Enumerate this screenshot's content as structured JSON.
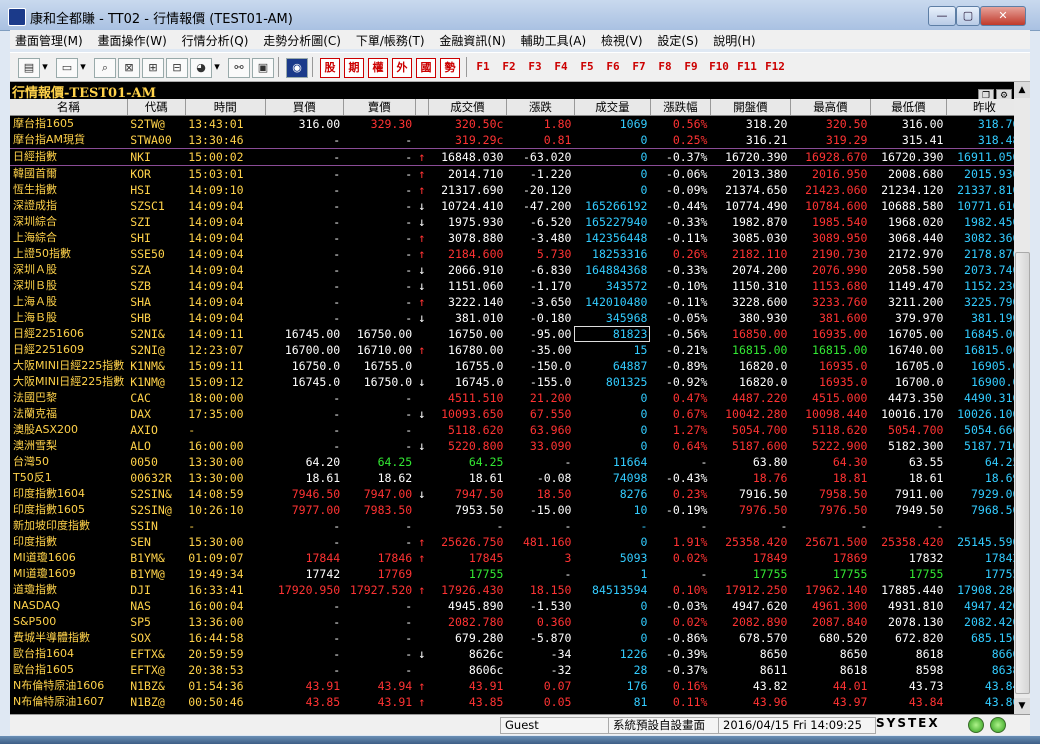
{
  "window": {
    "title": "康和全都賺 - TT02 - 行情報價 (TEST01-AM)",
    "minimize": "—",
    "maximize": "▢",
    "close": "✕"
  },
  "menu": [
    "畫面管理(M)",
    "畫面操作(W)",
    "行情分析(Q)",
    "走勢分析圖(C)",
    "下單/帳務(T)",
    "金融資訊(N)",
    "輔助工具(A)",
    "檢視(V)",
    "設定(S)",
    "說明(H)"
  ],
  "toolbar": {
    "red_buttons": [
      "股",
      "期",
      "權",
      "外",
      "國",
      "勢"
    ],
    "fkeys": [
      "F1",
      "F2",
      "F3",
      "F4",
      "F5",
      "F6",
      "F7",
      "F8",
      "F9",
      "F10",
      "F11",
      "F12"
    ]
  },
  "panel": {
    "title": "行情報價-TEST01-AM"
  },
  "columns": [
    "名稱",
    "代碼",
    "時間",
    "買價",
    "賣價",
    "成交價",
    "漲跌",
    "成交量",
    "漲跌幅",
    "開盤價",
    "最高價",
    "最低價",
    "昨收"
  ],
  "rows": [
    {
      "name": "摩台指1605",
      "code": "S2TW@",
      "time": "13:43:01",
      "bid": "316.00",
      "bidc": "w",
      "ask": "329.30",
      "askc": "r",
      "arrow": "",
      "last": "320.50c",
      "lastc": "r",
      "chg": "1.80",
      "chgc": "r",
      "vol": "1069",
      "pct": "0.56%",
      "pctc": "r",
      "open": "318.20",
      "openc": "w",
      "high": "320.50",
      "highc": "r",
      "low": "316.00",
      "lowc": "w",
      "prev": "318.70"
    },
    {
      "name": "摩台指AM現貨",
      "code": "STWA00",
      "time": "13:30:46",
      "bid": "-",
      "bidc": "w",
      "ask": "-",
      "askc": "w",
      "arrow": "",
      "last": "319.29c",
      "lastc": "r",
      "chg": "0.81",
      "chgc": "r",
      "vol": "0",
      "pct": "0.25%",
      "pctc": "r",
      "open": "316.21",
      "openc": "w",
      "high": "319.29",
      "highc": "r",
      "low": "315.41",
      "lowc": "w",
      "prev": "318.48"
    },
    {
      "name": "日經指數",
      "code": "NKI",
      "time": "15:00:02",
      "bid": "-",
      "bidc": "w",
      "ask": "-",
      "askc": "w",
      "arrow": "↑",
      "last": "16848.030",
      "lastc": "w",
      "chg": "-63.020",
      "chgc": "w",
      "vol": "0",
      "pct": "-0.37%",
      "pctc": "w",
      "open": "16720.390",
      "openc": "w",
      "high": "16928.670",
      "highc": "r",
      "low": "16720.390",
      "lowc": "w",
      "prev": "16911.050",
      "sel": true
    },
    {
      "name": "韓國首爾",
      "code": "KOR",
      "time": "15:03:01",
      "bid": "-",
      "bidc": "w",
      "ask": "-",
      "askc": "w",
      "arrow": "↑",
      "last": "2014.710",
      "lastc": "w",
      "chg": "-1.220",
      "chgc": "w",
      "vol": "0",
      "pct": "-0.06%",
      "pctc": "w",
      "open": "2013.380",
      "openc": "w",
      "high": "2016.950",
      "highc": "r",
      "low": "2008.680",
      "lowc": "w",
      "prev": "2015.930"
    },
    {
      "name": "恆生指數",
      "code": "HSI",
      "time": "14:09:10",
      "bid": "-",
      "bidc": "w",
      "ask": "-",
      "askc": "w",
      "arrow": "↑",
      "last": "21317.690",
      "lastc": "w",
      "chg": "-20.120",
      "chgc": "w",
      "vol": "0",
      "pct": "-0.09%",
      "pctc": "w",
      "open": "21374.650",
      "openc": "w",
      "high": "21423.060",
      "highc": "r",
      "low": "21234.120",
      "lowc": "w",
      "prev": "21337.810"
    },
    {
      "name": "深證成指",
      "code": "SZSC1",
      "time": "14:09:04",
      "bid": "-",
      "bidc": "w",
      "ask": "-",
      "askc": "w",
      "arrow": "↓",
      "last": "10724.410",
      "lastc": "w",
      "chg": "-47.200",
      "chgc": "w",
      "vol": "165266192",
      "pct": "-0.44%",
      "pctc": "w",
      "open": "10774.490",
      "openc": "w",
      "high": "10784.600",
      "highc": "r",
      "low": "10688.580",
      "lowc": "w",
      "prev": "10771.610"
    },
    {
      "name": "深圳綜合",
      "code": "SZI",
      "time": "14:09:04",
      "bid": "-",
      "bidc": "w",
      "ask": "-",
      "askc": "w",
      "arrow": "↓",
      "last": "1975.930",
      "lastc": "w",
      "chg": "-6.520",
      "chgc": "w",
      "vol": "165227940",
      "pct": "-0.33%",
      "pctc": "w",
      "open": "1982.870",
      "openc": "w",
      "high": "1985.540",
      "highc": "r",
      "low": "1968.020",
      "lowc": "w",
      "prev": "1982.450"
    },
    {
      "name": "上海綜合",
      "code": "SHI",
      "time": "14:09:04",
      "bid": "-",
      "bidc": "w",
      "ask": "-",
      "askc": "w",
      "arrow": "↑",
      "last": "3078.880",
      "lastc": "w",
      "chg": "-3.480",
      "chgc": "w",
      "vol": "142356448",
      "pct": "-0.11%",
      "pctc": "w",
      "open": "3085.030",
      "openc": "w",
      "high": "3089.950",
      "highc": "r",
      "low": "3068.440",
      "lowc": "w",
      "prev": "3082.360"
    },
    {
      "name": "上證50指數",
      "code": "SSE50",
      "time": "14:09:04",
      "bid": "-",
      "bidc": "w",
      "ask": "-",
      "askc": "w",
      "arrow": "↑",
      "last": "2184.600",
      "lastc": "r",
      "chg": "5.730",
      "chgc": "r",
      "vol": "18253316",
      "pct": "0.26%",
      "pctc": "r",
      "open": "2182.110",
      "openc": "r",
      "high": "2190.730",
      "highc": "r",
      "low": "2172.970",
      "lowc": "w",
      "prev": "2178.870"
    },
    {
      "name": "深圳Ａ股",
      "code": "SZA",
      "time": "14:09:04",
      "bid": "-",
      "bidc": "w",
      "ask": "-",
      "askc": "w",
      "arrow": "↓",
      "last": "2066.910",
      "lastc": "w",
      "chg": "-6.830",
      "chgc": "w",
      "vol": "164884368",
      "pct": "-0.33%",
      "pctc": "w",
      "open": "2074.200",
      "openc": "w",
      "high": "2076.990",
      "highc": "r",
      "low": "2058.590",
      "lowc": "w",
      "prev": "2073.740"
    },
    {
      "name": "深圳Ｂ股",
      "code": "SZB",
      "time": "14:09:04",
      "bid": "-",
      "bidc": "w",
      "ask": "-",
      "askc": "w",
      "arrow": "↓",
      "last": "1151.060",
      "lastc": "w",
      "chg": "-1.170",
      "chgc": "w",
      "vol": "343572",
      "pct": "-0.10%",
      "pctc": "w",
      "open": "1150.310",
      "openc": "w",
      "high": "1153.680",
      "highc": "r",
      "low": "1149.470",
      "lowc": "w",
      "prev": "1152.230"
    },
    {
      "name": "上海Ａ股",
      "code": "SHA",
      "time": "14:09:04",
      "bid": "-",
      "bidc": "w",
      "ask": "-",
      "askc": "w",
      "arrow": "↑",
      "last": "3222.140",
      "lastc": "w",
      "chg": "-3.650",
      "chgc": "w",
      "vol": "142010480",
      "pct": "-0.11%",
      "pctc": "w",
      "open": "3228.600",
      "openc": "w",
      "high": "3233.760",
      "highc": "r",
      "low": "3211.200",
      "lowc": "w",
      "prev": "3225.790"
    },
    {
      "name": "上海Ｂ股",
      "code": "SHB",
      "time": "14:09:04",
      "bid": "-",
      "bidc": "w",
      "ask": "-",
      "askc": "w",
      "arrow": "↓",
      "last": "381.010",
      "lastc": "w",
      "chg": "-0.180",
      "chgc": "w",
      "vol": "345968",
      "pct": "-0.05%",
      "pctc": "w",
      "open": "380.930",
      "openc": "w",
      "high": "381.600",
      "highc": "r",
      "low": "379.970",
      "lowc": "w",
      "prev": "381.190"
    },
    {
      "name": "日經2251606",
      "code": "S2NI&",
      "time": "14:09:11",
      "bid": "16745.00",
      "bidc": "w",
      "ask": "16750.00",
      "askc": "w",
      "arrow": "",
      "last": "16750.00",
      "lastc": "w",
      "chg": "-95.00",
      "chgc": "w",
      "vol": "81823",
      "volbox": true,
      "pct": "-0.56%",
      "pctc": "w",
      "open": "16850.00",
      "openc": "r",
      "high": "16935.00",
      "highc": "r",
      "low": "16705.00",
      "lowc": "w",
      "prev": "16845.00"
    },
    {
      "name": "日經2251609",
      "code": "S2NI@",
      "time": "12:23:07",
      "bid": "16700.00",
      "bidc": "w",
      "ask": "16710.00",
      "askc": "w",
      "arrow": "↑",
      "last": "16780.00",
      "lastc": "w",
      "chg": "-35.00",
      "chgc": "w",
      "vol": "15",
      "pct": "-0.21%",
      "pctc": "w",
      "open": "16815.00",
      "openc": "g",
      "high": "16815.00",
      "highc": "g",
      "low": "16740.00",
      "lowc": "w",
      "prev": "16815.00"
    },
    {
      "name": "大阪MINI日經225指數",
      "code": "K1NM&",
      "time": "15:09:11",
      "bid": "16750.0",
      "bidc": "w",
      "ask": "16755.0",
      "askc": "w",
      "arrow": "",
      "last": "16755.0",
      "lastc": "w",
      "chg": "-150.0",
      "chgc": "w",
      "vol": "64887",
      "pct": "-0.89%",
      "pctc": "w",
      "open": "16820.0",
      "openc": "w",
      "high": "16935.0",
      "highc": "r",
      "low": "16705.0",
      "lowc": "w",
      "prev": "16905.0"
    },
    {
      "name": "大阪MINI日經225指數",
      "code": "K1NM@",
      "time": "15:09:12",
      "bid": "16745.0",
      "bidc": "w",
      "ask": "16750.0",
      "askc": "w",
      "arrow": "↓",
      "last": "16745.0",
      "lastc": "w",
      "chg": "-155.0",
      "chgc": "w",
      "vol": "801325",
      "pct": "-0.92%",
      "pctc": "w",
      "open": "16820.0",
      "openc": "w",
      "high": "16935.0",
      "highc": "r",
      "low": "16700.0",
      "lowc": "w",
      "prev": "16900.0"
    },
    {
      "name": "法國巴黎",
      "code": "CAC",
      "time": "18:00:00",
      "bid": "-",
      "bidc": "w",
      "ask": "-",
      "askc": "w",
      "arrow": "",
      "last": "4511.510",
      "lastc": "r",
      "chg": "21.200",
      "chgc": "r",
      "vol": "0",
      "pct": "0.47%",
      "pctc": "r",
      "open": "4487.220",
      "openc": "r",
      "high": "4515.000",
      "highc": "r",
      "low": "4473.350",
      "lowc": "w",
      "prev": "4490.310"
    },
    {
      "name": "法蘭克福",
      "code": "DAX",
      "time": "17:35:00",
      "bid": "-",
      "bidc": "w",
      "ask": "-",
      "askc": "w",
      "arrow": "↓",
      "last": "10093.650",
      "lastc": "r",
      "chg": "67.550",
      "chgc": "r",
      "vol": "0",
      "pct": "0.67%",
      "pctc": "r",
      "open": "10042.280",
      "openc": "r",
      "high": "10098.440",
      "highc": "r",
      "low": "10016.170",
      "lowc": "w",
      "prev": "10026.100"
    },
    {
      "name": "澳股ASX200",
      "code": "AXIO",
      "time": "-",
      "bid": "-",
      "bidc": "w",
      "ask": "-",
      "askc": "w",
      "arrow": "",
      "last": "5118.620",
      "lastc": "r",
      "chg": "63.960",
      "chgc": "r",
      "vol": "0",
      "pct": "1.27%",
      "pctc": "r",
      "open": "5054.700",
      "openc": "r",
      "high": "5118.620",
      "highc": "r",
      "low": "5054.700",
      "lowc": "r",
      "prev": "5054.660"
    },
    {
      "name": "澳洲雪梨",
      "code": "ALO",
      "time": "16:00:00",
      "bid": "-",
      "bidc": "w",
      "ask": "-",
      "askc": "w",
      "arrow": "↓",
      "last": "5220.800",
      "lastc": "r",
      "chg": "33.090",
      "chgc": "r",
      "vol": "0",
      "pct": "0.64%",
      "pctc": "r",
      "open": "5187.600",
      "openc": "r",
      "high": "5222.900",
      "highc": "r",
      "low": "5182.300",
      "lowc": "w",
      "prev": "5187.710"
    },
    {
      "name": "台灣50",
      "code": "0050",
      "time": "13:30:00",
      "bid": "64.20",
      "bidc": "w",
      "ask": "64.25",
      "askc": "g",
      "arrow": "",
      "last": "64.25",
      "lastc": "g",
      "chg": "-",
      "chgc": "w",
      "vol": "11664",
      "pct": "-",
      "pctc": "w",
      "open": "63.80",
      "openc": "w",
      "high": "64.30",
      "highc": "r",
      "low": "63.55",
      "lowc": "w",
      "prev": "64.25"
    },
    {
      "name": "T50反1",
      "code": "00632R",
      "time": "13:30:00",
      "bid": "18.61",
      "bidc": "w",
      "ask": "18.62",
      "askc": "w",
      "arrow": "",
      "last": "18.61",
      "lastc": "w",
      "chg": "-0.08",
      "chgc": "w",
      "vol": "74098",
      "pct": "-0.43%",
      "pctc": "w",
      "open": "18.76",
      "openc": "r",
      "high": "18.81",
      "highc": "r",
      "low": "18.61",
      "lowc": "w",
      "prev": "18.69"
    },
    {
      "name": "印度指數1604",
      "code": "S2SIN&",
      "time": "14:08:59",
      "bid": "7946.50",
      "bidc": "r",
      "ask": "7947.00",
      "askc": "r",
      "arrow": "↓",
      "last": "7947.50",
      "lastc": "r",
      "chg": "18.50",
      "chgc": "r",
      "vol": "8276",
      "pct": "0.23%",
      "pctc": "r",
      "open": "7916.50",
      "openc": "w",
      "high": "7958.50",
      "highc": "r",
      "low": "7911.00",
      "lowc": "w",
      "prev": "7929.00"
    },
    {
      "name": "印度指數1605",
      "code": "S2SIN@",
      "time": "10:26:10",
      "bid": "7977.00",
      "bidc": "r",
      "ask": "7983.50",
      "askc": "r",
      "arrow": "",
      "last": "7953.50",
      "lastc": "w",
      "chg": "-15.00",
      "chgc": "w",
      "vol": "10",
      "pct": "-0.19%",
      "pctc": "w",
      "open": "7976.50",
      "openc": "r",
      "high": "7976.50",
      "highc": "r",
      "low": "7949.50",
      "lowc": "w",
      "prev": "7968.50"
    },
    {
      "name": "新加坡印度指數",
      "code": "SSIN",
      "time": "-",
      "bid": "-",
      "bidc": "w",
      "ask": "-",
      "askc": "w",
      "arrow": "",
      "last": "-",
      "lastc": "w",
      "chg": "-",
      "chgc": "w",
      "vol": "-",
      "pct": "-",
      "pctc": "w",
      "open": "-",
      "openc": "w",
      "high": "-",
      "highc": "w",
      "low": "-",
      "lowc": "w",
      "prev": "-"
    },
    {
      "name": "印度指數",
      "code": "SEN",
      "time": "15:30:00",
      "bid": "-",
      "bidc": "w",
      "ask": "-",
      "askc": "w",
      "arrow": "↑",
      "last": "25626.750",
      "lastc": "r",
      "chg": "481.160",
      "chgc": "r",
      "vol": "0",
      "pct": "1.91%",
      "pctc": "r",
      "open": "25358.420",
      "openc": "r",
      "high": "25671.500",
      "highc": "r",
      "low": "25358.420",
      "lowc": "r",
      "prev": "25145.590"
    },
    {
      "name": "MI道瓊1606",
      "code": "B1YM&",
      "time": "01:09:07",
      "bid": "17844",
      "bidc": "r",
      "ask": "17846",
      "askc": "r",
      "arrow": "↑",
      "last": "17845",
      "lastc": "r",
      "chg": "3",
      "chgc": "r",
      "vol": "5093",
      "pct": "0.02%",
      "pctc": "r",
      "open": "17849",
      "openc": "r",
      "high": "17869",
      "highc": "r",
      "low": "17832",
      "lowc": "w",
      "prev": "17842"
    },
    {
      "name": "MI道瓊1609",
      "code": "B1YM@",
      "time": "19:49:34",
      "bid": "17742",
      "bidc": "w",
      "ask": "17769",
      "askc": "r",
      "arrow": "",
      "last": "17755",
      "lastc": "g",
      "chg": "-",
      "chgc": "w",
      "vol": "1",
      "pct": "-",
      "pctc": "w",
      "open": "17755",
      "openc": "g",
      "high": "17755",
      "highc": "g",
      "low": "17755",
      "lowc": "g",
      "prev": "17755"
    },
    {
      "name": "道瓊指數",
      "code": "DJI",
      "time": "16:33:41",
      "bid": "17920.950",
      "bidc": "r",
      "ask": "17927.520",
      "askc": "r",
      "arrow": "↑",
      "last": "17926.430",
      "lastc": "r",
      "chg": "18.150",
      "chgc": "r",
      "vol": "84513594",
      "pct": "0.10%",
      "pctc": "r",
      "open": "17912.250",
      "openc": "r",
      "high": "17962.140",
      "highc": "r",
      "low": "17885.440",
      "lowc": "w",
      "prev": "17908.280"
    },
    {
      "name": "NASDAQ",
      "code": "NAS",
      "time": "16:00:04",
      "bid": "-",
      "bidc": "w",
      "ask": "-",
      "askc": "w",
      "arrow": "",
      "last": "4945.890",
      "lastc": "w",
      "chg": "-1.530",
      "chgc": "w",
      "vol": "0",
      "pct": "-0.03%",
      "pctc": "w",
      "open": "4947.620",
      "openc": "w",
      "high": "4961.300",
      "highc": "r",
      "low": "4931.810",
      "lowc": "w",
      "prev": "4947.420"
    },
    {
      "name": "S&P500",
      "code": "SP5",
      "time": "13:36:00",
      "bid": "-",
      "bidc": "w",
      "ask": "-",
      "askc": "w",
      "arrow": "",
      "last": "2082.780",
      "lastc": "r",
      "chg": "0.360",
      "chgc": "r",
      "vol": "0",
      "pct": "0.02%",
      "pctc": "r",
      "open": "2082.890",
      "openc": "r",
      "high": "2087.840",
      "highc": "r",
      "low": "2078.130",
      "lowc": "w",
      "prev": "2082.420"
    },
    {
      "name": "費城半導體指數",
      "code": "SOX",
      "time": "16:44:58",
      "bid": "-",
      "bidc": "w",
      "ask": "-",
      "askc": "w",
      "arrow": "",
      "last": "679.280",
      "lastc": "w",
      "chg": "-5.870",
      "chgc": "w",
      "vol": "0",
      "pct": "-0.86%",
      "pctc": "w",
      "open": "678.570",
      "openc": "w",
      "high": "680.520",
      "highc": "w",
      "low": "672.820",
      "lowc": "w",
      "prev": "685.150"
    },
    {
      "name": "歐台指1604",
      "code": "EFTX&",
      "time": "20:59:59",
      "bid": "-",
      "bidc": "w",
      "ask": "-",
      "askc": "w",
      "arrow": "↓",
      "last": "8626c",
      "lastc": "w",
      "chg": "-34",
      "chgc": "w",
      "vol": "1226",
      "pct": "-0.39%",
      "pctc": "w",
      "open": "8650",
      "openc": "w",
      "high": "8650",
      "highc": "w",
      "low": "8618",
      "lowc": "w",
      "prev": "8660"
    },
    {
      "name": "歐台指1605",
      "code": "EFTX@",
      "time": "20:38:53",
      "bid": "-",
      "bidc": "w",
      "ask": "-",
      "askc": "w",
      "arrow": "",
      "last": "8606c",
      "lastc": "w",
      "chg": "-32",
      "chgc": "w",
      "vol": "28",
      "pct": "-0.37%",
      "pctc": "w",
      "open": "8611",
      "openc": "w",
      "high": "8618",
      "highc": "w",
      "low": "8598",
      "lowc": "w",
      "prev": "8638"
    },
    {
      "name": "N布倫特原油1606",
      "code": "N1BZ&",
      "time": "01:54:36",
      "bid": "43.91",
      "bidc": "r",
      "ask": "43.94",
      "askc": "r",
      "arrow": "↑",
      "last": "43.91",
      "lastc": "r",
      "chg": "0.07",
      "chgc": "r",
      "vol": "176",
      "pct": "0.16%",
      "pctc": "r",
      "open": "43.82",
      "openc": "w",
      "high": "44.01",
      "highc": "r",
      "low": "43.73",
      "lowc": "w",
      "prev": "43.84"
    },
    {
      "name": "N布倫特原油1607",
      "code": "N1BZ@",
      "time": "00:50:46",
      "bid": "43.85",
      "bidc": "r",
      "ask": "43.91",
      "askc": "r",
      "arrow": "↑",
      "last": "43.85",
      "lastc": "r",
      "chg": "0.05",
      "chgc": "r",
      "vol": "81",
      "pct": "0.11%",
      "pctc": "r",
      "open": "43.96",
      "openc": "r",
      "high": "43.97",
      "highc": "r",
      "low": "43.84",
      "lowc": "r",
      "prev": "43.80"
    }
  ],
  "status": {
    "user": "Guest",
    "message": "系統預設自設畫面",
    "datetime": "2016/04/15 Fri 14:09:25",
    "brand": "SYSTEX"
  },
  "colors": {
    "w": "#ffffff",
    "r": "#ff3333",
    "g": "#33e833",
    "cy": "#33ccff",
    "gold": "#ffd24a"
  }
}
